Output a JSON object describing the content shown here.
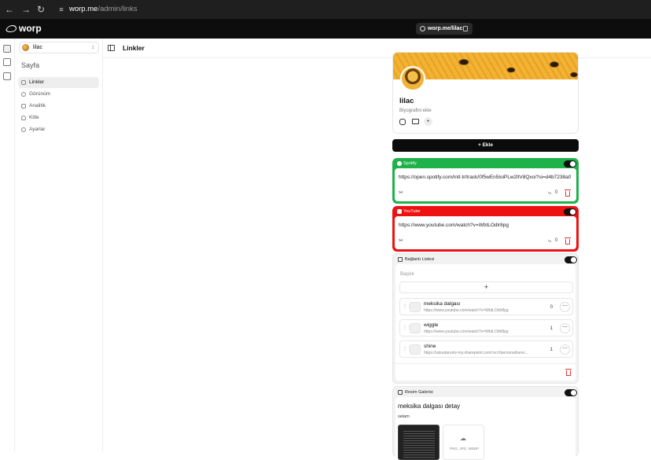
{
  "browser": {
    "url_host": "worp.me",
    "url_path": "/admin/links",
    "back_icon": "back-arrow-icon",
    "forward_icon": "forward-arrow-icon",
    "reload_icon": "reload-icon"
  },
  "app": {
    "logo_text": "worp",
    "public_link": "worp.me/lilac"
  },
  "sidebar": {
    "page_name": "lilac",
    "section_title": "Sayfa",
    "items": [
      {
        "label": "Linkler",
        "active": true
      },
      {
        "label": "Görünüm",
        "active": false
      },
      {
        "label": "Analitik",
        "active": false
      },
      {
        "label": "Kitle",
        "active": false
      },
      {
        "label": "Ayarlar",
        "active": false
      }
    ]
  },
  "topbar": {
    "title": "Linkler"
  },
  "profile": {
    "name": "lilac",
    "bio_placeholder": "Biyografini ekle",
    "socials": [
      "instagram-icon",
      "mail-icon",
      "plus-icon"
    ]
  },
  "add_button": {
    "label": "+ Ekle"
  },
  "cards": {
    "spotify": {
      "title": "Spotify",
      "color": "#1fb14a",
      "url": "https://open.spotify.com/intl-tr/track/0f5wEn5loiPLw2ltV8Qxoi?si=d4b7238a0",
      "clicks": "0",
      "enabled": true
    },
    "youtube": {
      "title": "YouTube",
      "color": "#ee1111",
      "url": "https://www.youtube.com/watch?v=WbtLOdlr8pg",
      "clicks": "0",
      "enabled": true
    },
    "collection": {
      "title": "Bağlantı Listesi",
      "heading_placeholder": "Başlık",
      "add_symbol": "+",
      "enabled": true,
      "items": [
        {
          "title": "meksika dalgası",
          "url": "https://www.youtube.com/watch?v=WbtLOdlr8pg",
          "clicks": "0"
        },
        {
          "title": "wiggle",
          "url": "https://www.youtube.com/watch?v=WbtLOdlr8pg",
          "clicks": "1"
        },
        {
          "title": "shine",
          "url": "https://uskudaruniv-my.sharepoint.com/:w:/r/personal/sevv...",
          "clicks": "1"
        }
      ]
    },
    "gallery": {
      "title": "Resim Galerisi",
      "heading": "meksika dalgası detay",
      "description": "selam",
      "upload_hint": "PNG, JPG, WEBP",
      "enabled": true
    }
  }
}
